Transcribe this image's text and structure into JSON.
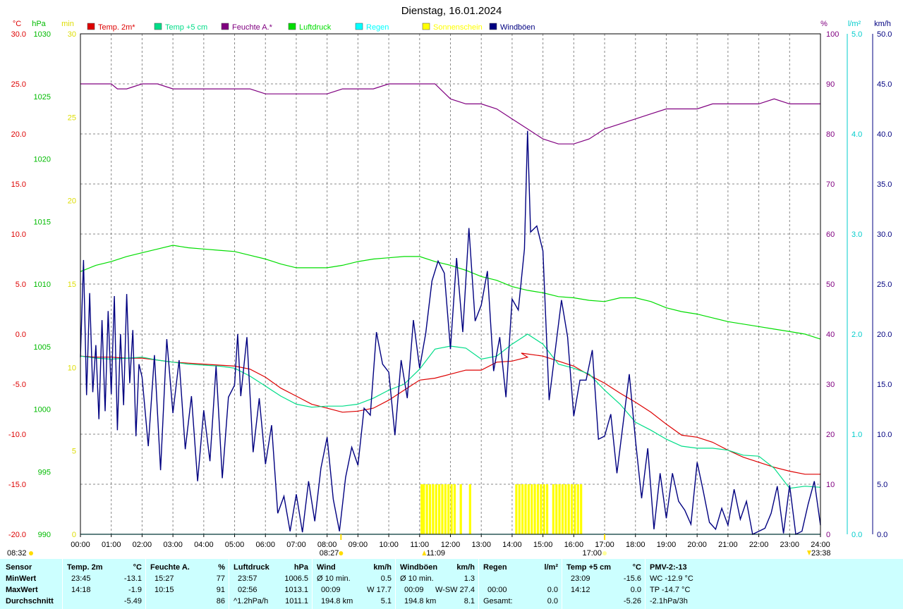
{
  "title": "Dienstag, 16.01.2024",
  "legend": [
    {
      "label": "Temp. 2m*",
      "color": "#dd0000"
    },
    {
      "label": "Temp +5 cm",
      "color": "#00dd88"
    },
    {
      "label": "Feuchte A.*",
      "color": "#800080"
    },
    {
      "label": "Luftdruck",
      "color": "#00dd00"
    },
    {
      "label": "Regen",
      "color": "#00ffff"
    },
    {
      "label": "Sonnenschein",
      "color": "#ffff00"
    },
    {
      "label": "Windböen",
      "color": "#000080"
    }
  ],
  "axes": {
    "temp": {
      "unit": "°C",
      "color": "#dd0000",
      "ticks": [
        "30.0",
        "25.0",
        "20.0",
        "15.0",
        "10.0",
        "5.0",
        "0.0",
        "-5.0",
        "-10.0",
        "-15.0",
        "-20.0"
      ]
    },
    "pressure": {
      "unit": "hPa",
      "color": "#00bb00",
      "ticks": [
        "1030",
        "1025",
        "1020",
        "1015",
        "1010",
        "1005",
        "1000",
        "995",
        "990"
      ]
    },
    "minutes": {
      "unit": "min",
      "color": "#dddd00",
      "ticks": [
        "30",
        "25",
        "20",
        "15",
        "10",
        "5",
        "0"
      ]
    },
    "humidity": {
      "unit": "%",
      "color": "#800080",
      "ticks": [
        "100",
        "90",
        "80",
        "70",
        "60",
        "50",
        "40",
        "30",
        "20",
        "10",
        "0"
      ]
    },
    "rain": {
      "unit": "l/m²",
      "color": "#00cccc",
      "ticks": [
        "5.0",
        "4.0",
        "3.0",
        "2.0",
        "1.0",
        "0.0"
      ]
    },
    "wind": {
      "unit": "km/h",
      "color": "#000080",
      "ticks": [
        "50.0",
        "45.0",
        "40.0",
        "35.0",
        "30.0",
        "25.0",
        "20.0",
        "15.0",
        "10.0",
        "5.0",
        "0.0"
      ]
    },
    "x_ticks": [
      "00:00",
      "01:00",
      "02:00",
      "03:00",
      "04:00",
      "05:00",
      "06:00",
      "07:00",
      "08:00",
      "09:00",
      "10:00",
      "11:00",
      "12:00",
      "13:00",
      "14:00",
      "15:00",
      "16:00",
      "17:00",
      "18:00",
      "19:00",
      "20:00",
      "21:00",
      "22:00",
      "23:00",
      "24:00"
    ]
  },
  "markers": {
    "sunrise": "08:27",
    "noon": "11:09",
    "sunset": "17:00",
    "moonrise": "08:32",
    "moonset": "23:38"
  },
  "chart_data": {
    "type": "line",
    "title": "Dienstag, 16.01.2024",
    "xlim": [
      0,
      24
    ],
    "x_unit": "hours",
    "ylim_temp": [
      -20,
      30
    ],
    "ylim_pressure": [
      990,
      1030
    ],
    "ylim_humidity": [
      0,
      100
    ],
    "ylim_rain": [
      0,
      5
    ],
    "ylim_wind": [
      0,
      50
    ],
    "ylim_minutes": [
      0,
      30
    ],
    "series": [
      {
        "name": "Temp. 2m*",
        "axis": "temp",
        "color": "#dd0000",
        "x": [
          0,
          0.5,
          1,
          1.5,
          2,
          2.5,
          3,
          3.5,
          4,
          4.5,
          5,
          5.5,
          6,
          6.5,
          7,
          7.5,
          8,
          8.5,
          9,
          9.5,
          10,
          10.5,
          11,
          11.5,
          12,
          12.5,
          13,
          13.5,
          14,
          14.5,
          14.3,
          15,
          15.5,
          16,
          16.5,
          17,
          17.5,
          18,
          18.5,
          19,
          19.5,
          20,
          20.5,
          21,
          21.5,
          22,
          22.5,
          23,
          23.5,
          24
        ],
        "y": [
          -2.2,
          -2.3,
          -2.3,
          -2.4,
          -2.4,
          -2.6,
          -2.8,
          -2.9,
          -3.0,
          -3.1,
          -3.2,
          -3.5,
          -4.3,
          -5.4,
          -6.2,
          -7.0,
          -7.4,
          -7.8,
          -7.7,
          -7.4,
          -6.6,
          -5.6,
          -4.6,
          -4.4,
          -4.0,
          -3.6,
          -3.6,
          -2.8,
          -2.7,
          -2.3,
          -1.9,
          -2.2,
          -2.7,
          -3.2,
          -4.1,
          -4.9,
          -5.9,
          -6.8,
          -7.8,
          -9.0,
          -10.1,
          -10.3,
          -10.8,
          -11.6,
          -12.3,
          -12.8,
          -13.3,
          -13.7,
          -14.0,
          -14.0
        ]
      },
      {
        "name": "Temp +5 cm",
        "axis": "temp",
        "color": "#00dd88",
        "x": [
          0,
          0.5,
          1,
          1.5,
          2,
          2.5,
          3,
          3.5,
          4,
          4.5,
          5,
          5.5,
          6,
          6.5,
          7,
          7.5,
          8,
          8.5,
          9,
          9.5,
          10,
          10.5,
          11,
          11.5,
          12,
          12.5,
          13,
          13.5,
          14,
          14.5,
          15,
          15.5,
          16,
          16.5,
          17,
          17.5,
          18,
          18.5,
          19,
          19.5,
          20,
          20.5,
          21,
          21.5,
          22,
          22.5,
          23,
          23.5,
          24
        ],
        "y": [
          -2.2,
          -2.4,
          -2.5,
          -2.4,
          -2.3,
          -2.6,
          -2.8,
          -3.0,
          -3.1,
          -3.2,
          -3.4,
          -4.2,
          -5.2,
          -6.2,
          -7.0,
          -7.3,
          -7.2,
          -7.2,
          -7.0,
          -6.4,
          -5.6,
          -5.0,
          -3.5,
          -1.5,
          -1.2,
          -1.4,
          -2.5,
          -2.2,
          -1.0,
          0.0,
          -1.0,
          -3.0,
          -3.4,
          -4.0,
          -5.6,
          -7.0,
          -8.8,
          -9.6,
          -10.5,
          -11.2,
          -11.4,
          -11.4,
          -11.6,
          -12.1,
          -12.2,
          -13.4,
          -15.4,
          -15.2,
          -15.3
        ]
      },
      {
        "name": "Feuchte A.*",
        "axis": "humidity",
        "color": "#800080",
        "x": [
          0,
          0.5,
          1,
          1.2,
          1.5,
          2,
          2.5,
          3,
          3.5,
          4,
          4.5,
          5,
          5.5,
          6,
          6.5,
          7,
          7.5,
          8,
          8.5,
          9,
          9.5,
          10,
          10.5,
          11,
          11.5,
          12,
          12.5,
          13,
          13.5,
          14,
          14.5,
          15,
          15.5,
          16,
          16.5,
          17,
          17.5,
          18,
          18.5,
          19,
          19.5,
          20,
          20.5,
          21,
          21.5,
          22,
          22.5,
          23,
          23.5,
          24
        ],
        "y": [
          90,
          90,
          90,
          89,
          89,
          90,
          90,
          89,
          89,
          89,
          89,
          89,
          89,
          88,
          88,
          88,
          88,
          88,
          89,
          89,
          89,
          90,
          90,
          90,
          90,
          87,
          86,
          86,
          85,
          83,
          81,
          79,
          78,
          78,
          79,
          81,
          82,
          83,
          84,
          85,
          85,
          85,
          86,
          86,
          86,
          86,
          87,
          86,
          86,
          86
        ]
      },
      {
        "name": "Luftdruck",
        "axis": "pressure",
        "color": "#00dd00",
        "x": [
          0,
          0.5,
          1,
          1.5,
          2,
          2.5,
          3,
          3.5,
          4,
          4.5,
          5,
          5.5,
          6,
          6.5,
          7,
          7.5,
          8,
          8.5,
          9,
          9.5,
          10,
          10.5,
          11,
          11.5,
          12,
          12.5,
          13,
          13.5,
          14,
          14.5,
          15,
          15.5,
          16,
          16.5,
          17,
          17.5,
          18,
          18.5,
          19,
          19.5,
          20,
          20.5,
          21,
          21.5,
          22,
          22.5,
          23,
          23.5,
          24
        ],
        "y": [
          1011.0,
          1011.5,
          1011.8,
          1012.2,
          1012.5,
          1012.8,
          1013.1,
          1012.9,
          1012.8,
          1012.7,
          1012.6,
          1012.3,
          1012.0,
          1011.6,
          1011.3,
          1011.3,
          1011.3,
          1011.5,
          1011.8,
          1012.0,
          1012.1,
          1012.2,
          1012.2,
          1011.8,
          1011.5,
          1011.1,
          1010.6,
          1010.3,
          1009.8,
          1009.5,
          1009.3,
          1009.0,
          1008.9,
          1008.7,
          1008.6,
          1008.9,
          1008.9,
          1008.6,
          1008.1,
          1007.8,
          1007.6,
          1007.3,
          1007.0,
          1006.8,
          1006.6,
          1006.4,
          1006.2,
          1006.0,
          1005.6
        ]
      },
      {
        "name": "Regen",
        "axis": "rain",
        "color": "#00ffff",
        "x": [
          0,
          24
        ],
        "y": [
          0,
          0
        ]
      },
      {
        "name": "Windböen",
        "axis": "wind",
        "color": "#000080",
        "x": [
          0,
          0.1,
          0.2,
          0.3,
          0.4,
          0.5,
          0.6,
          0.7,
          0.8,
          0.9,
          1,
          1.1,
          1.2,
          1.3,
          1.4,
          1.5,
          1.6,
          1.7,
          1.8,
          1.9,
          2,
          2.2,
          2.4,
          2.6,
          2.8,
          3,
          3.2,
          3.4,
          3.6,
          3.8,
          4,
          4.2,
          4.4,
          4.6,
          4.8,
          5,
          5.1,
          5.2,
          5.4,
          5.6,
          5.8,
          6,
          6.2,
          6.4,
          6.6,
          6.8,
          7,
          7.2,
          7.4,
          7.6,
          7.8,
          8,
          8.2,
          8.4,
          8.6,
          8.8,
          9,
          9.2,
          9.4,
          9.6,
          9.8,
          10,
          10.2,
          10.4,
          10.6,
          10.8,
          11,
          11.2,
          11.4,
          11.6,
          11.8,
          12,
          12.2,
          12.4,
          12.6,
          12.8,
          13,
          13.2,
          13.4,
          13.6,
          13.8,
          14,
          14.2,
          14.4,
          14.5,
          14.6,
          14.8,
          15,
          15.2,
          15.4,
          15.6,
          15.8,
          16,
          16.2,
          16.4,
          16.6,
          16.8,
          17,
          17.2,
          17.4,
          17.6,
          17.8,
          18,
          18.2,
          18.4,
          18.6,
          18.8,
          19,
          19.2,
          19.4,
          19.6,
          19.8,
          20,
          20.2,
          20.4,
          20.6,
          20.8,
          21,
          21.2,
          21.4,
          21.6,
          21.8,
          22,
          22.2,
          22.4,
          22.6,
          22.8,
          23,
          23.2,
          23.4,
          23.6,
          23.8,
          24
        ],
        "y": [
          17.7,
          27.4,
          13.9,
          24.1,
          14.2,
          18.9,
          11.5,
          21.4,
          12.3,
          22.3,
          14.0,
          23.8,
          10.4,
          20.0,
          12.9,
          24.0,
          15.1,
          20.4,
          9.8,
          17.0,
          15.7,
          8.8,
          17.9,
          6.4,
          19.5,
          12.1,
          17.4,
          8.5,
          13.8,
          5.3,
          12.4,
          7.3,
          16.8,
          5.6,
          13.7,
          14.9,
          20.0,
          13.8,
          19.7,
          8.2,
          13.6,
          7.0,
          10.9,
          2.1,
          3.8,
          0.3,
          4.0,
          0.2,
          5.3,
          1.3,
          6.6,
          9.7,
          3.5,
          0.3,
          5.7,
          8.7,
          6.9,
          12.6,
          11.9,
          20.2,
          17.0,
          16.2,
          9.9,
          17.4,
          13.6,
          21.4,
          16.6,
          20.1,
          25.3,
          27.3,
          26.1,
          18.5,
          27.6,
          20.2,
          30.6,
          21.3,
          22.9,
          26.3,
          16.3,
          19.7,
          13.7,
          23.5,
          22.4,
          28.5,
          40.3,
          30.2,
          30.8,
          28.3,
          13.4,
          18.4,
          23.4,
          19.7,
          11.8,
          15.4,
          15.4,
          18.4,
          9.5,
          9.8,
          12.0,
          6.1,
          11.1,
          16.0,
          9.4,
          3.6,
          8.6,
          0.5,
          6.1,
          1.6,
          6.1,
          3.3,
          2.4,
          1.0,
          7.2,
          4.3,
          1.2,
          0.5,
          2.6,
          0.9,
          4.5,
          1.5,
          3.3,
          0.0,
          0.3,
          0.6,
          2.1,
          4.8,
          0.1,
          4.9,
          0.0,
          0.3,
          3.0,
          5.3,
          0.9
        ]
      },
      {
        "name": "Sonnenschein",
        "axis": "minutes",
        "color": "#ffff00",
        "type": "bar",
        "x": [
          11.03,
          11.1,
          11.2,
          11.3,
          11.4,
          11.5,
          11.6,
          11.7,
          11.8,
          11.9,
          12.0,
          12.1,
          12.3,
          12.6,
          14.1,
          14.2,
          14.3,
          14.4,
          14.5,
          14.6,
          14.7,
          14.8,
          14.9,
          15.0,
          15.1,
          15.3,
          15.4,
          15.5,
          15.6,
          15.7,
          15.8,
          15.9,
          16.0,
          16.1,
          16.2
        ],
        "y": [
          3,
          3,
          3,
          3,
          3,
          3,
          3,
          3,
          3,
          3,
          3,
          3,
          3,
          3,
          3,
          3,
          3,
          3,
          3,
          3,
          3,
          3,
          3,
          3,
          3,
          3,
          3,
          3,
          3,
          3,
          3,
          3,
          3,
          3,
          3
        ]
      }
    ]
  },
  "stats": {
    "row_labels": [
      "Sensor",
      "MinWert",
      "MaxWert",
      "Durchschnitt"
    ],
    "temp2m": {
      "header": "Temp. 2m",
      "unit": "°C",
      "min_time": "23:45",
      "min": "-13.1",
      "max_time": "14:18",
      "max": "-1.9",
      "avg": "-5.49"
    },
    "humidity": {
      "header": "Feuchte A.",
      "unit": "%",
      "min_time": "15:27",
      "min": "77",
      "max_time": "10:15",
      "max": "91",
      "avg": "86"
    },
    "pressure": {
      "header": "Luftdruck",
      "unit": "hPa",
      "min_time": "23:57",
      "min": "1006.5",
      "max_time": "02:56",
      "max": "1013.1",
      "avg_label": "^1.2hPa/h",
      "avg": "1011.1"
    },
    "wind": {
      "header": "Wind",
      "unit": "km/h",
      "r1_label": "Ø 10 min.",
      "r1_value": "0.5",
      "r2_time": "00:09",
      "r2_value": "W 17.7",
      "r3_label": "194.8 km",
      "r3_value": "5.1"
    },
    "gusts": {
      "header": "Windböen",
      "unit": "km/h",
      "r1_label": "Ø 10 min.",
      "r1_value": "1.3",
      "r2_time": "00:09",
      "r2_value": "W-SW 27.4",
      "r3_label": "194.8 km",
      "r3_value": "8.1"
    },
    "rain": {
      "header": "Regen",
      "unit": "l/m²",
      "r2_time": "00:00",
      "r2_value": "0.0",
      "r3_label": "Gesamt:",
      "r3_value": "0.0"
    },
    "temp5cm": {
      "header": "Temp +5 cm",
      "unit": "°C",
      "min_time": "23:09",
      "min": "-15.6",
      "max_time": "14:12",
      "max": "0.0",
      "avg": "-5.26"
    },
    "pmv": {
      "header": "PMV-2:-13",
      "line1": "WC -12.9 °C",
      "line2": "TP -14.7 °C",
      "line3": "-2.1hPa/3h"
    }
  }
}
